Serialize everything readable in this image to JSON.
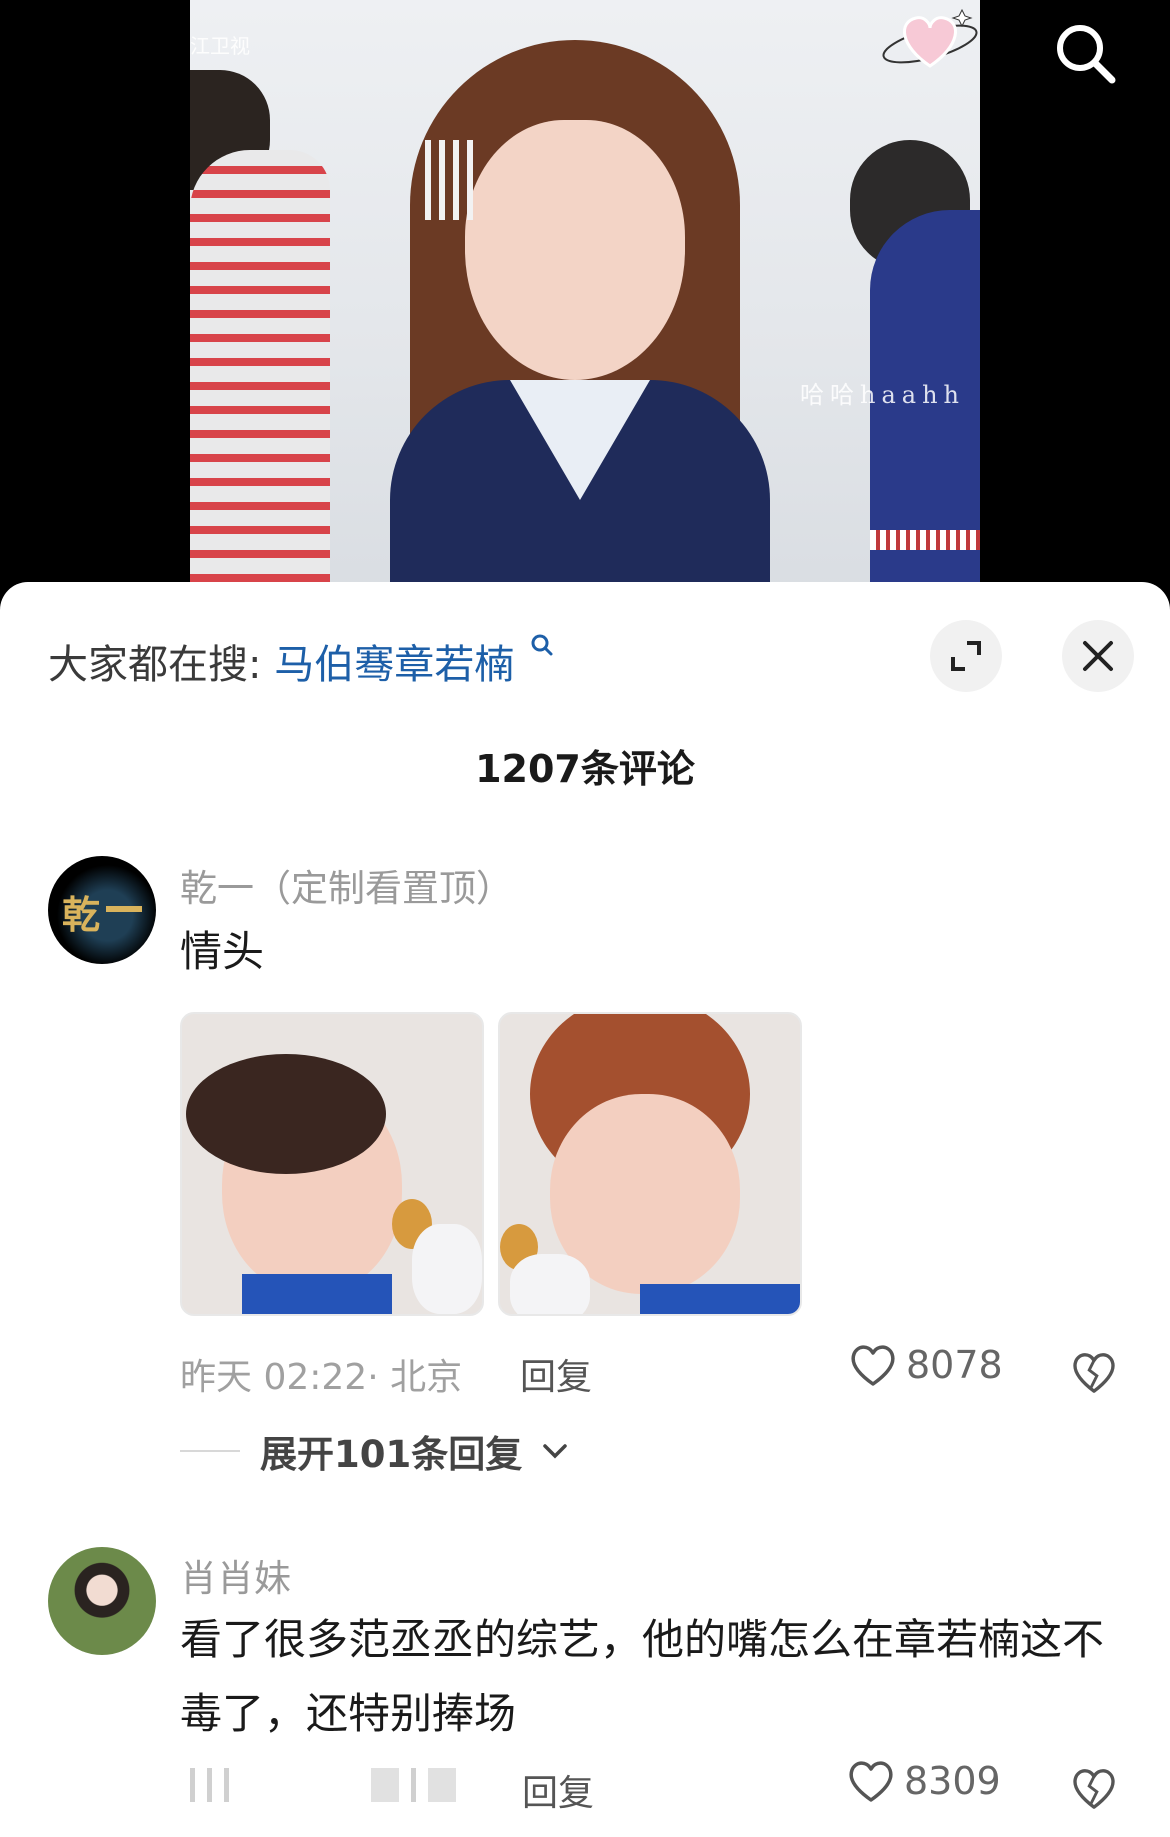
{
  "video": {
    "tv_logo": "江卫视",
    "watermark": "哈哈haahh"
  },
  "sheet": {
    "hot_search_prefix": "大家都在搜:",
    "hot_search_keyword": "马伯骞章若楠",
    "comment_count": "1207条评论"
  },
  "comments": [
    {
      "username": "乾一（定制看置顶）",
      "avatar_text": "乾",
      "text": "情头",
      "time": "昨天 02:22",
      "location": "· 北京",
      "reply_label": "回复",
      "likes": "8078",
      "expand_replies": "展开101条回复"
    },
    {
      "username": "肖肖妹",
      "text": "看了很多范丞丞的综艺，他的嘴怎么在章若楠这不毒了，还特别捧场",
      "reply_label": "回复",
      "likes": "8309"
    }
  ],
  "colors": {
    "keyword": "#1d5fa8",
    "text_primary": "#1a1a1a",
    "text_secondary": "#9a9a9a"
  }
}
